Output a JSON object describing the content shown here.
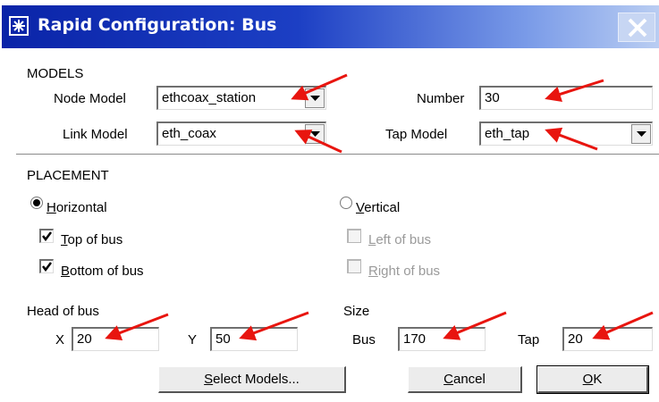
{
  "window": {
    "title": "Rapid Configuration: Bus",
    "icons": {
      "app": "asterisk-icon",
      "close": "close-icon"
    }
  },
  "models": {
    "heading": "MODELS",
    "node_model_label": "Node Model",
    "node_model_value": "ethcoax_station",
    "number_label": "Number",
    "number_value": "30",
    "link_model_label": "Link Model",
    "link_model_value": "eth_coax",
    "tap_model_label": "Tap Model",
    "tap_model_value": "eth_tap"
  },
  "placement": {
    "heading": "PLACEMENT",
    "horizontal": {
      "pre": "",
      "ul": "H",
      "post": "orizontal",
      "selected": true
    },
    "vertical": {
      "pre": "",
      "ul": "V",
      "post": "ertical",
      "selected": false
    },
    "top_of_bus": {
      "ul": "T",
      "post": "op of bus",
      "checked": true,
      "enabled": true
    },
    "bottom_of_bus": {
      "ul": "B",
      "post": "ottom of bus",
      "checked": true,
      "enabled": true
    },
    "left_of_bus": {
      "ul": "L",
      "post": "eft of bus",
      "checked": false,
      "enabled": false
    },
    "right_of_bus": {
      "ul": "R",
      "post": "ight of bus",
      "checked": false,
      "enabled": false
    }
  },
  "head_of_bus": {
    "heading": "Head of bus",
    "x_label": "X",
    "x_value": "20",
    "y_label": "Y",
    "y_value": "50"
  },
  "size": {
    "heading": "Size",
    "bus_label": "Bus",
    "bus_value": "170",
    "tap_label": "Tap",
    "tap_value": "20"
  },
  "buttons": {
    "select_models": {
      "ul": "S",
      "post": "elect Models..."
    },
    "cancel": {
      "ul": "C",
      "post": "ancel"
    },
    "ok": {
      "ul": "O",
      "post": "K"
    }
  },
  "colors": {
    "titlebar_start": "#0a24a8",
    "titlebar_end": "#b9cdf2",
    "annotation_arrow": "#e8150f"
  }
}
